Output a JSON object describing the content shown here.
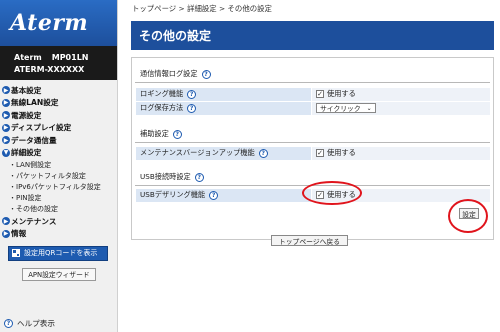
{
  "brand": {
    "logo_text": "Aterm"
  },
  "device": {
    "model_prefix": "Aterm",
    "model": "MP01LN",
    "name": "ATERM-XXXXXX"
  },
  "sidebar": {
    "items": [
      {
        "label": "基本設定",
        "type": "section"
      },
      {
        "label": "無線LAN設定",
        "type": "section"
      },
      {
        "label": "電源設定",
        "type": "section"
      },
      {
        "label": "ディスプレイ設定",
        "type": "section"
      },
      {
        "label": "データ通信量",
        "type": "section"
      },
      {
        "label": "詳細設定",
        "type": "section"
      },
      {
        "label": "LAN側設定",
        "type": "sub"
      },
      {
        "label": "パケットフィルタ設定",
        "type": "sub"
      },
      {
        "label": "IPv6パケットフィルタ設定",
        "type": "sub"
      },
      {
        "label": "PIN設定",
        "type": "sub"
      },
      {
        "label": "その他の設定",
        "type": "sub"
      },
      {
        "label": "メンテナンス",
        "type": "section"
      },
      {
        "label": "情報",
        "type": "section"
      }
    ],
    "qr_button": "設定用QRコードを表示",
    "apn_button": "APN設定ウィザード",
    "help_link": "ヘルプ表示"
  },
  "breadcrumb": "トップページ > 詳細設定 > その他の設定",
  "page_title": "その他の設定",
  "sections": {
    "log": {
      "heading": "通信情報ログ設定",
      "logging_label": "ロギング機能",
      "logging_value": "使用する",
      "save_label": "ログ保存方法",
      "save_value": "サイクリック"
    },
    "assist": {
      "heading": "補助設定",
      "maint_label": "メンテナンスバージョンアップ機能",
      "maint_value": "使用する"
    },
    "usb": {
      "heading": "USB接続時設定",
      "tether_label": "USBデザリング機能",
      "tether_value": "使用する"
    }
  },
  "buttons": {
    "set": "設定",
    "back_to_top": "トップページへ戻る"
  },
  "icons": {
    "help": "?",
    "checkmark": "✓",
    "dropdown": "⌄",
    "bullet": "▶"
  },
  "colors": {
    "brand_blue": "#1d4f9c",
    "highlight_red": "#e0141c",
    "label_bg": "#dbe6f4"
  }
}
